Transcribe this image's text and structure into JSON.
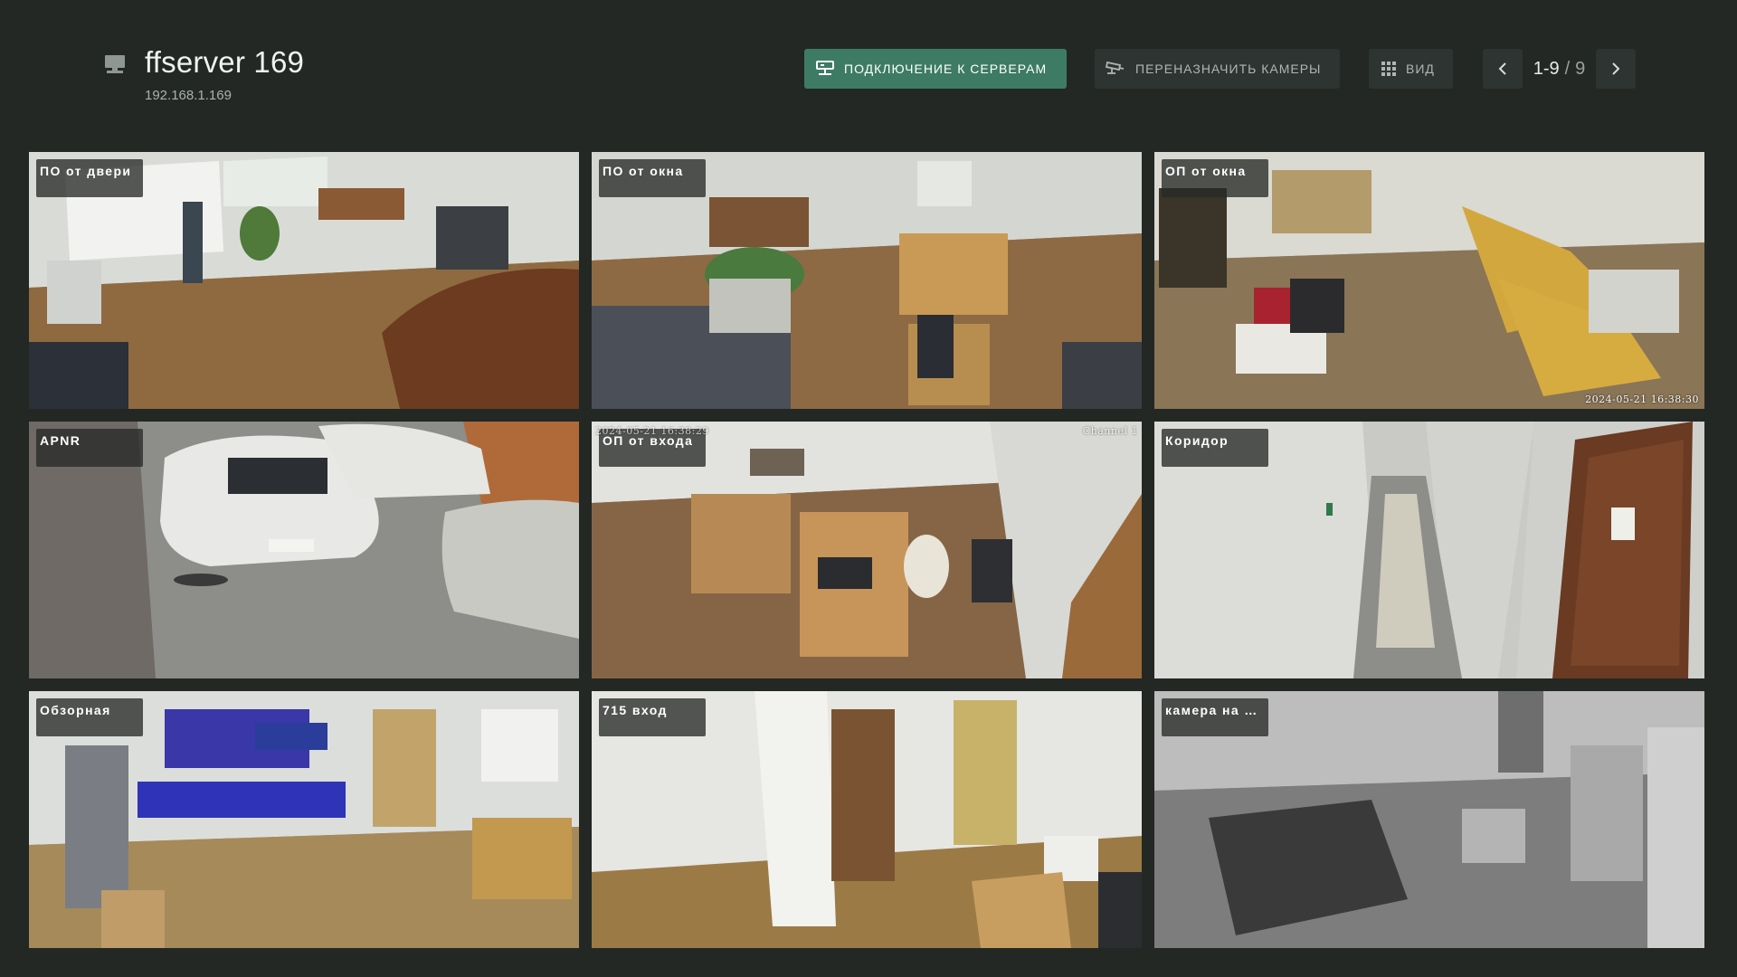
{
  "header": {
    "server_name": "ffserver 169",
    "server_ip": "192.168.1.169",
    "server_icon": "monitor-icon"
  },
  "toolbar": {
    "connect_label": "Подключение к серверам",
    "connect_icon": "server-connect-icon",
    "reassign_label": "Переназначить камеры",
    "reassign_icon": "camera-cctv-icon",
    "view_label": "Вид",
    "view_icon": "grid-icon"
  },
  "pager": {
    "range": "1-9",
    "separator": "/",
    "total": "9"
  },
  "cameras": [
    {
      "label": "ПО от двери",
      "scene": "office-whiteboard"
    },
    {
      "label": "ПО от окна",
      "scene": "office-desks"
    },
    {
      "label": "ОП от окна",
      "scene": "office-yellow-desks",
      "timestamp": "2024-05-21 16:38:30"
    },
    {
      "label": "APNR",
      "scene": "parking-cars"
    },
    {
      "label": "ОП от входа",
      "scene": "office-entrance",
      "timestamp": "2024-05-21 16:38:29",
      "channel": "Channel 1"
    },
    {
      "label": "Коридор",
      "scene": "corridor"
    },
    {
      "label": "Обзорная",
      "scene": "server-room"
    },
    {
      "label": "715 вход",
      "scene": "entrance-715"
    },
    {
      "label": "камера на …",
      "scene": "storage-mono"
    }
  ],
  "colors": {
    "background": "#232825",
    "accent": "#3d7b64",
    "button_bg": "#2e3431"
  }
}
